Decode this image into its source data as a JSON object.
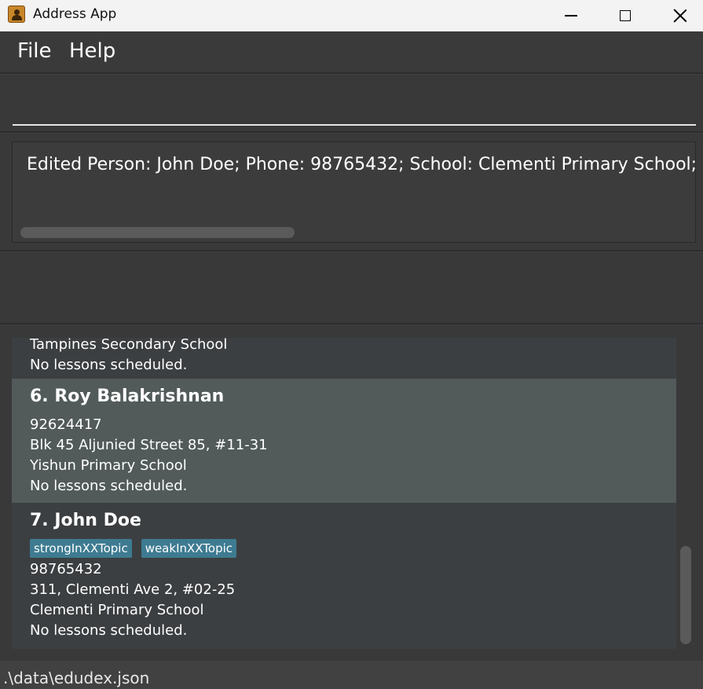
{
  "window": {
    "title": "Address App"
  },
  "menu": {
    "file": "File",
    "help": "Help"
  },
  "command": {
    "value": ""
  },
  "result": {
    "text": "Edited Person: John Doe; Phone: 98765432; School: Clementi Primary School; ..."
  },
  "persons": [
    {
      "lines": [
        "Tampines Secondary School",
        "No lessons scheduled."
      ]
    },
    {
      "name": "6. Roy Balakrishnan",
      "lines": [
        "92624417",
        "Blk 45 Aljunied Street 85, #11-31",
        "Yishun Primary School",
        "No lessons scheduled."
      ]
    },
    {
      "name": "7. John Doe",
      "tags": [
        "strongInXXTopic",
        "weakInXXTopic"
      ],
      "lines": [
        "98765432",
        "311, Clementi Ave 2, #02-25",
        "Clementi Primary School",
        "No lessons scheduled."
      ]
    }
  ],
  "status": {
    "path": ".\\data\\edudex.json"
  },
  "icons": {
    "app": "address-book-icon",
    "minimize": "minimize-icon",
    "maximize": "maximize-icon",
    "close": "close-icon"
  },
  "colors": {
    "tag_background": "#3e7b91",
    "selected_card": "#525a5a",
    "background": "#3c3f41"
  }
}
